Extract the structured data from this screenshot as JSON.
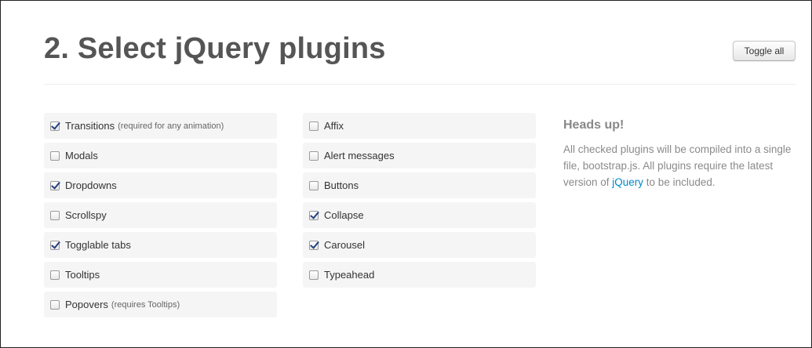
{
  "header": {
    "title": "2. Select jQuery plugins",
    "toggle_label": "Toggle all"
  },
  "plugins_left": [
    {
      "label": "Transitions",
      "note": "(required for any animation)",
      "checked": true
    },
    {
      "label": "Modals",
      "note": "",
      "checked": false
    },
    {
      "label": "Dropdowns",
      "note": "",
      "checked": true
    },
    {
      "label": "Scrollspy",
      "note": "",
      "checked": false
    },
    {
      "label": "Togglable tabs",
      "note": "",
      "checked": true
    },
    {
      "label": "Tooltips",
      "note": "",
      "checked": false
    },
    {
      "label": "Popovers",
      "note": "(requires Tooltips)",
      "checked": false
    }
  ],
  "plugins_mid": [
    {
      "label": "Affix",
      "note": "",
      "checked": false
    },
    {
      "label": "Alert messages",
      "note": "",
      "checked": false
    },
    {
      "label": "Buttons",
      "note": "",
      "checked": false
    },
    {
      "label": "Collapse",
      "note": "",
      "checked": true
    },
    {
      "label": "Carousel",
      "note": "",
      "checked": true
    },
    {
      "label": "Typeahead",
      "note": "",
      "checked": false
    }
  ],
  "info": {
    "heading": "Heads up!",
    "text_before": "All checked plugins will be compiled into a single file, bootstrap.js. All plugins require the latest version of ",
    "link": "jQuery",
    "text_after": " to be included."
  },
  "colors": {
    "link": "#0088cc",
    "check": "#25407f",
    "row_bg": "#f5f5f5"
  }
}
